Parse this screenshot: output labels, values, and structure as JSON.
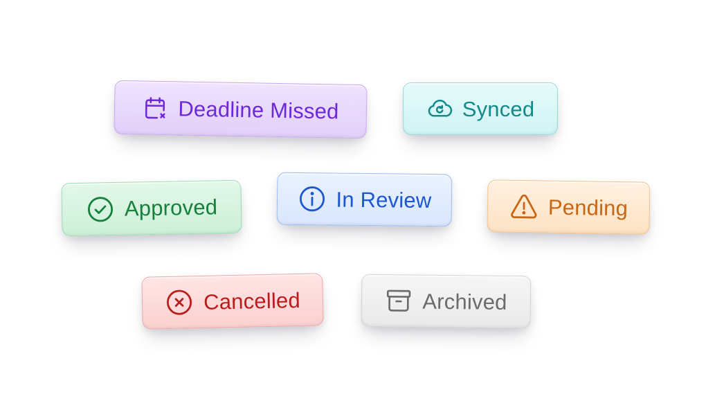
{
  "badges": {
    "deadline_missed": {
      "label": "Deadline Missed",
      "icon": "calendar-x-icon",
      "color": "#6d28d9"
    },
    "synced": {
      "label": "Synced",
      "icon": "cloud-sync-icon",
      "color": "#138a8a"
    },
    "approved": {
      "label": "Approved",
      "icon": "check-circle-icon",
      "color": "#16803c"
    },
    "in_review": {
      "label": "In Review",
      "icon": "info-circle-icon",
      "color": "#1d57cf"
    },
    "pending": {
      "label": "Pending",
      "icon": "warning-triangle-icon",
      "color": "#c96613"
    },
    "cancelled": {
      "label": "Cancelled",
      "icon": "x-circle-icon",
      "color": "#b91c1c"
    },
    "archived": {
      "label": "Archived",
      "icon": "archive-box-icon",
      "color": "#6b6b6b"
    }
  }
}
